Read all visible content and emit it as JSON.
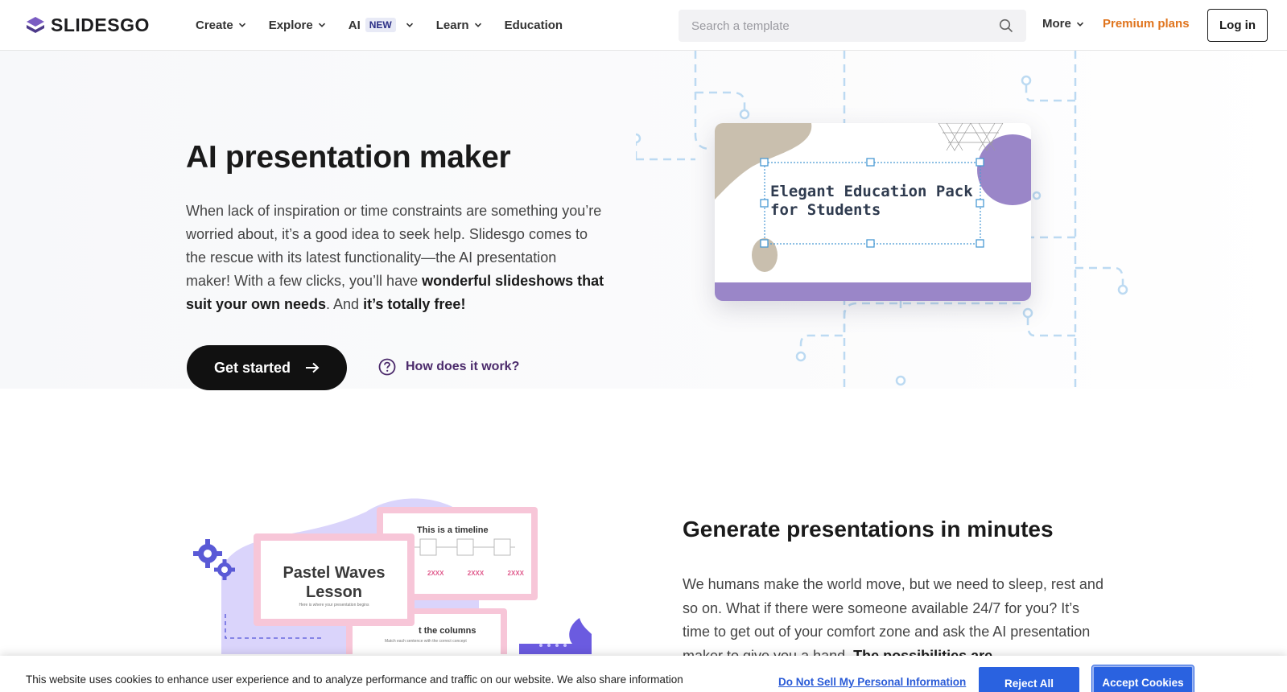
{
  "header": {
    "logo_text": "SLIDESGO",
    "nav": [
      {
        "label": "Create",
        "has_dropdown": true
      },
      {
        "label": "Explore",
        "has_dropdown": true
      },
      {
        "label": "AI",
        "badge": "NEW",
        "has_dropdown": true
      },
      {
        "label": "Learn",
        "has_dropdown": true
      },
      {
        "label": "Education",
        "has_dropdown": false
      }
    ],
    "search_placeholder": "Search a template",
    "more_label": "More",
    "premium_label": "Premium plans",
    "login_label": "Log in"
  },
  "hero": {
    "title": "AI presentation maker",
    "text_1": "When lack of inspiration or time constraints are something you’re worried about, it’s a good idea to seek help. Slidesgo comes to the rescue with its latest functionality—the AI presentation maker! With a few clicks, you’ll have ",
    "text_bold_1": "wonderful slideshows that suit your own needs",
    "text_2": ". And ",
    "text_bold_2": "it’s totally free!",
    "cta_label": "Get started",
    "how_label": "How does it work?",
    "slide_title_line1": "Elegant Education Pack",
    "slide_title_line2": "for Students"
  },
  "section2": {
    "title": "Generate presentations in minutes",
    "text_1": "We humans make the world move, but we need to sleep, rest and so on. What if there were someone available 24/7 for you? It’s time to get out of your comfort zone and ask the AI presentation maker to give you a hand. ",
    "text_bold_1": "The possibilities are",
    "illus": {
      "card_main_title_1": "Pastel Waves",
      "card_main_title_2": "Lesson",
      "card_main_sub": "Here is where your presentation begins",
      "card_timeline_title": "This is a timeline",
      "timeline_labels": [
        "2XXX",
        "2XXX",
        "2XXX"
      ],
      "card_columns_title": "t the columns",
      "card_columns_sub": "Match each sentence with the correct concept"
    }
  },
  "cookie": {
    "text": "This website uses cookies to enhance user experience and to analyze performance and traffic on our website. We also share information",
    "dnsmi_label": "Do Not Sell My Personal Information",
    "reject_label": "Reject All",
    "accept_label": "Accept Cookies"
  },
  "colors": {
    "brand_purple": "#7a5cc2",
    "premium_orange": "#e0741d",
    "cookie_blue": "#2a62e0",
    "dashed_lines": "#bcdaf2"
  }
}
